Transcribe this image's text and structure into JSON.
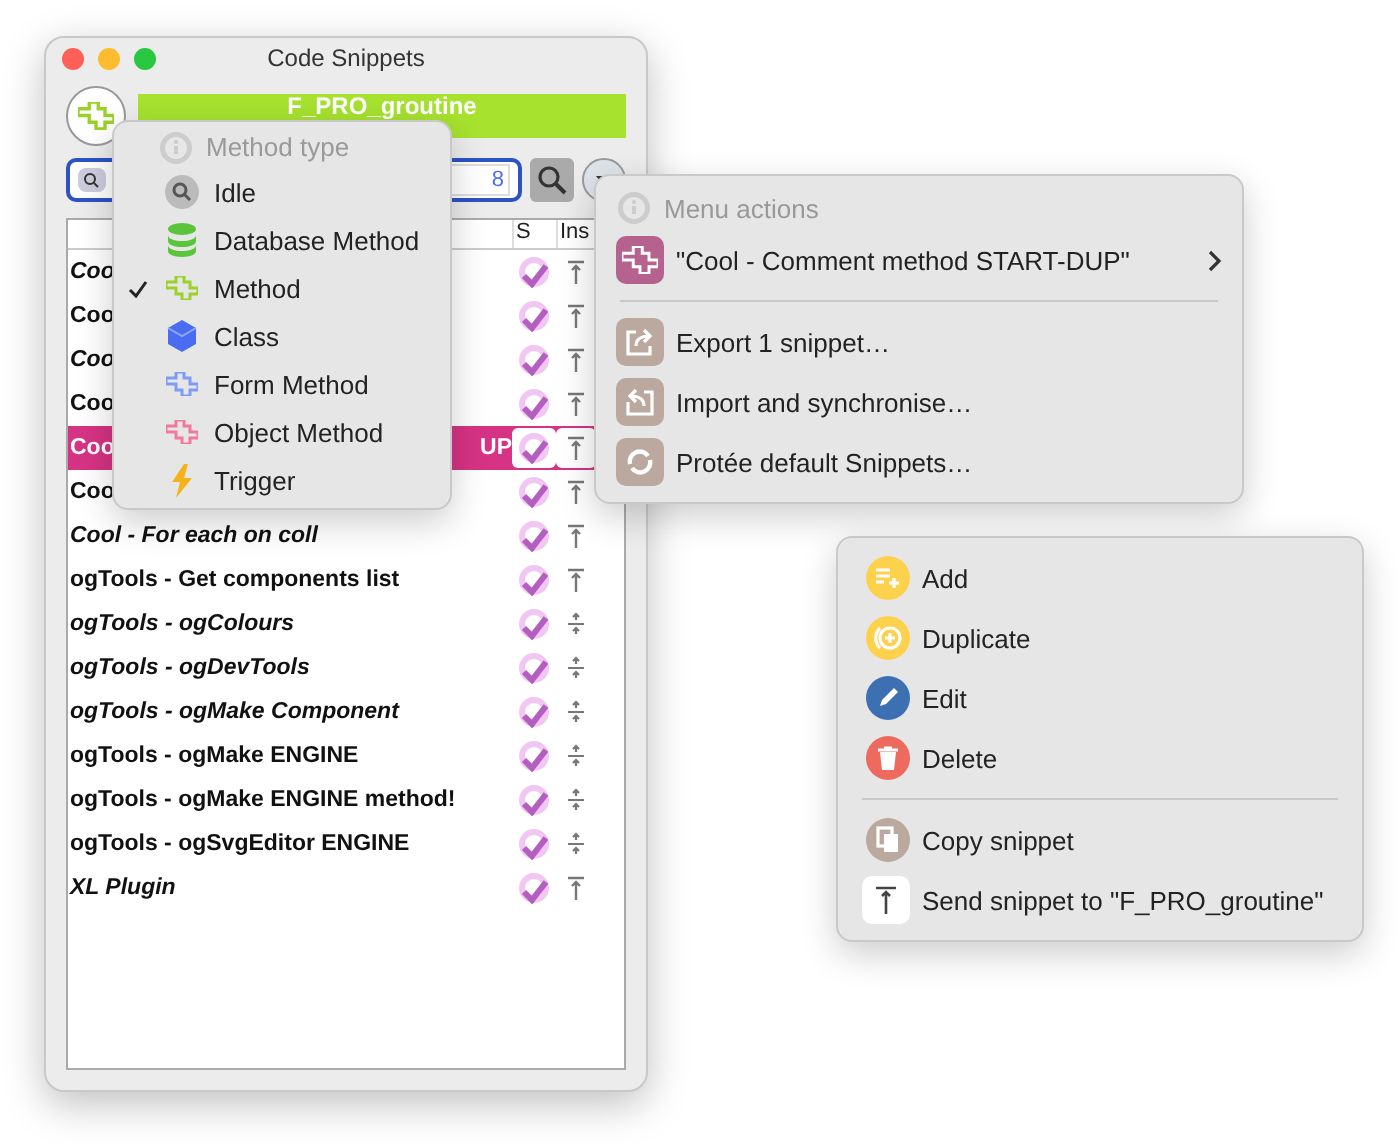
{
  "window": {
    "title": "Code Snippets"
  },
  "header": {
    "title": "F_PRO_groutine"
  },
  "search": {
    "value": "8"
  },
  "table": {
    "columns": [
      "S",
      "Ins"
    ],
    "rows": [
      {
        "name": "Coo",
        "italic": true,
        "selected": false,
        "kind": "top"
      },
      {
        "name": "Coo",
        "italic": false,
        "selected": false,
        "kind": "top"
      },
      {
        "name": "Coo",
        "italic": true,
        "selected": false,
        "kind": "top"
      },
      {
        "name": "Coo",
        "italic": false,
        "selected": false,
        "kind": "top"
      },
      {
        "name": "Coo",
        "tail": "UP",
        "italic": false,
        "selected": true,
        "kind": "top"
      },
      {
        "name": "Coo",
        "italic": false,
        "selected": false,
        "kind": "top"
      },
      {
        "name": "Cool - For each on coll",
        "italic": true,
        "selected": false,
        "kind": "top"
      },
      {
        "name": "ogTools - Get components list",
        "italic": false,
        "selected": false,
        "kind": "top"
      },
      {
        "name": "ogTools - ogColours",
        "italic": true,
        "selected": false,
        "kind": "split"
      },
      {
        "name": "ogTools - ogDevTools",
        "italic": true,
        "selected": false,
        "kind": "split"
      },
      {
        "name": "ogTools - ogMake Component",
        "italic": true,
        "selected": false,
        "kind": "split"
      },
      {
        "name": "ogTools - ogMake ENGINE",
        "italic": false,
        "selected": false,
        "kind": "split"
      },
      {
        "name": "ogTools - ogMake ENGINE method!",
        "italic": false,
        "selected": false,
        "kind": "split"
      },
      {
        "name": "ogTools - ogSvgEditor ENGINE",
        "italic": false,
        "selected": false,
        "kind": "split"
      },
      {
        "name": "XL Plugin",
        "italic": true,
        "selected": false,
        "kind": "top"
      }
    ]
  },
  "method_menu": {
    "header": "Method type",
    "items": [
      {
        "label": "Idle",
        "kind": "search",
        "checked": false
      },
      {
        "label": "Database Method",
        "kind": "database",
        "checked": false
      },
      {
        "label": "Method",
        "kind": "method",
        "checked": true
      },
      {
        "label": "Class",
        "kind": "class",
        "checked": false
      },
      {
        "label": "Form Method",
        "kind": "form",
        "checked": false
      },
      {
        "label": "Object Method",
        "kind": "object",
        "checked": false
      },
      {
        "label": "Trigger",
        "kind": "trigger",
        "checked": false
      }
    ]
  },
  "actions_menu": {
    "header": "Menu actions",
    "snippet": "\"Cool - Comment method START-DUP\"",
    "items": [
      {
        "label": "Export 1 snippet…",
        "kind": "export"
      },
      {
        "label": "Import and synchronise…",
        "kind": "import"
      },
      {
        "label": "Protée default Snippets…",
        "kind": "sync"
      }
    ]
  },
  "context_menu": {
    "groups": [
      [
        {
          "label": "Add",
          "kind": "add"
        },
        {
          "label": "Duplicate",
          "kind": "duplicate"
        },
        {
          "label": "Edit",
          "kind": "edit"
        },
        {
          "label": "Delete",
          "kind": "delete"
        }
      ],
      [
        {
          "label": "Copy snippet",
          "kind": "copy"
        },
        {
          "label": "Send snippet to \"F_PRO_groutine\"",
          "kind": "send"
        }
      ]
    ]
  }
}
